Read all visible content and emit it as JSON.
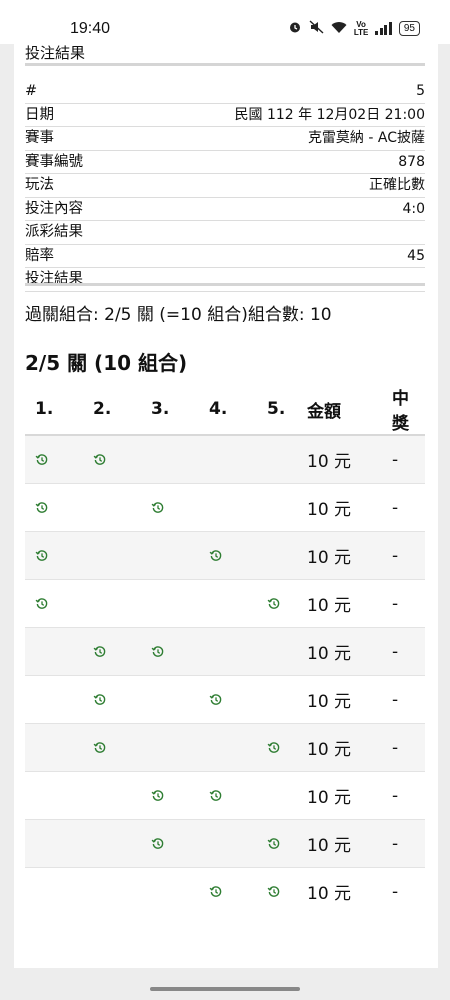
{
  "status_bar": {
    "time": "19:40",
    "volte_top": "Vo",
    "volte_bottom": "LTE",
    "battery": "95"
  },
  "bet_result_label_top": "投注結果",
  "details": [
    {
      "label": "#",
      "value": "5"
    },
    {
      "label": "日期",
      "value": "民國 112 年 12月02日 21:00"
    },
    {
      "label": "賽事",
      "value": "克雷莫納 - AC披薩"
    },
    {
      "label": "賽事編號",
      "value": "878"
    },
    {
      "label": "玩法",
      "value": "正確比數"
    },
    {
      "label": "投注內容",
      "value": "4:0"
    },
    {
      "label": "派彩結果",
      "value": ""
    },
    {
      "label": "賠率",
      "value": "45"
    },
    {
      "label": "投注結果",
      "value": ""
    }
  ],
  "combo_summary": "過關組合: 2/5 關 (=10 組合)組合數: 10",
  "section_title": "2/5 關 (10 組合)",
  "table": {
    "headers": [
      "1.",
      "2.",
      "3.",
      "4.",
      "5.",
      "金額",
      "中獎"
    ],
    "rows": [
      {
        "legs": [
          true,
          true,
          false,
          false,
          false
        ],
        "amount": "10 元",
        "win": "-"
      },
      {
        "legs": [
          true,
          false,
          true,
          false,
          false
        ],
        "amount": "10 元",
        "win": "-"
      },
      {
        "legs": [
          true,
          false,
          false,
          true,
          false
        ],
        "amount": "10 元",
        "win": "-"
      },
      {
        "legs": [
          true,
          false,
          false,
          false,
          true
        ],
        "amount": "10 元",
        "win": "-"
      },
      {
        "legs": [
          false,
          true,
          true,
          false,
          false
        ],
        "amount": "10 元",
        "win": "-"
      },
      {
        "legs": [
          false,
          true,
          false,
          true,
          false
        ],
        "amount": "10 元",
        "win": "-"
      },
      {
        "legs": [
          false,
          true,
          false,
          false,
          true
        ],
        "amount": "10 元",
        "win": "-"
      },
      {
        "legs": [
          false,
          false,
          true,
          true,
          false
        ],
        "amount": "10 元",
        "win": "-"
      },
      {
        "legs": [
          false,
          false,
          true,
          false,
          true
        ],
        "amount": "10 元",
        "win": "-"
      },
      {
        "legs": [
          false,
          false,
          false,
          true,
          true
        ],
        "amount": "10 元",
        "win": "-"
      }
    ]
  },
  "icons": {
    "leg_status": "clock-history-icon"
  },
  "colors": {
    "accent_green": "#2e7d32",
    "rule_gray": "#d5d5d5",
    "row_stripe": "#f5f5f5"
  }
}
